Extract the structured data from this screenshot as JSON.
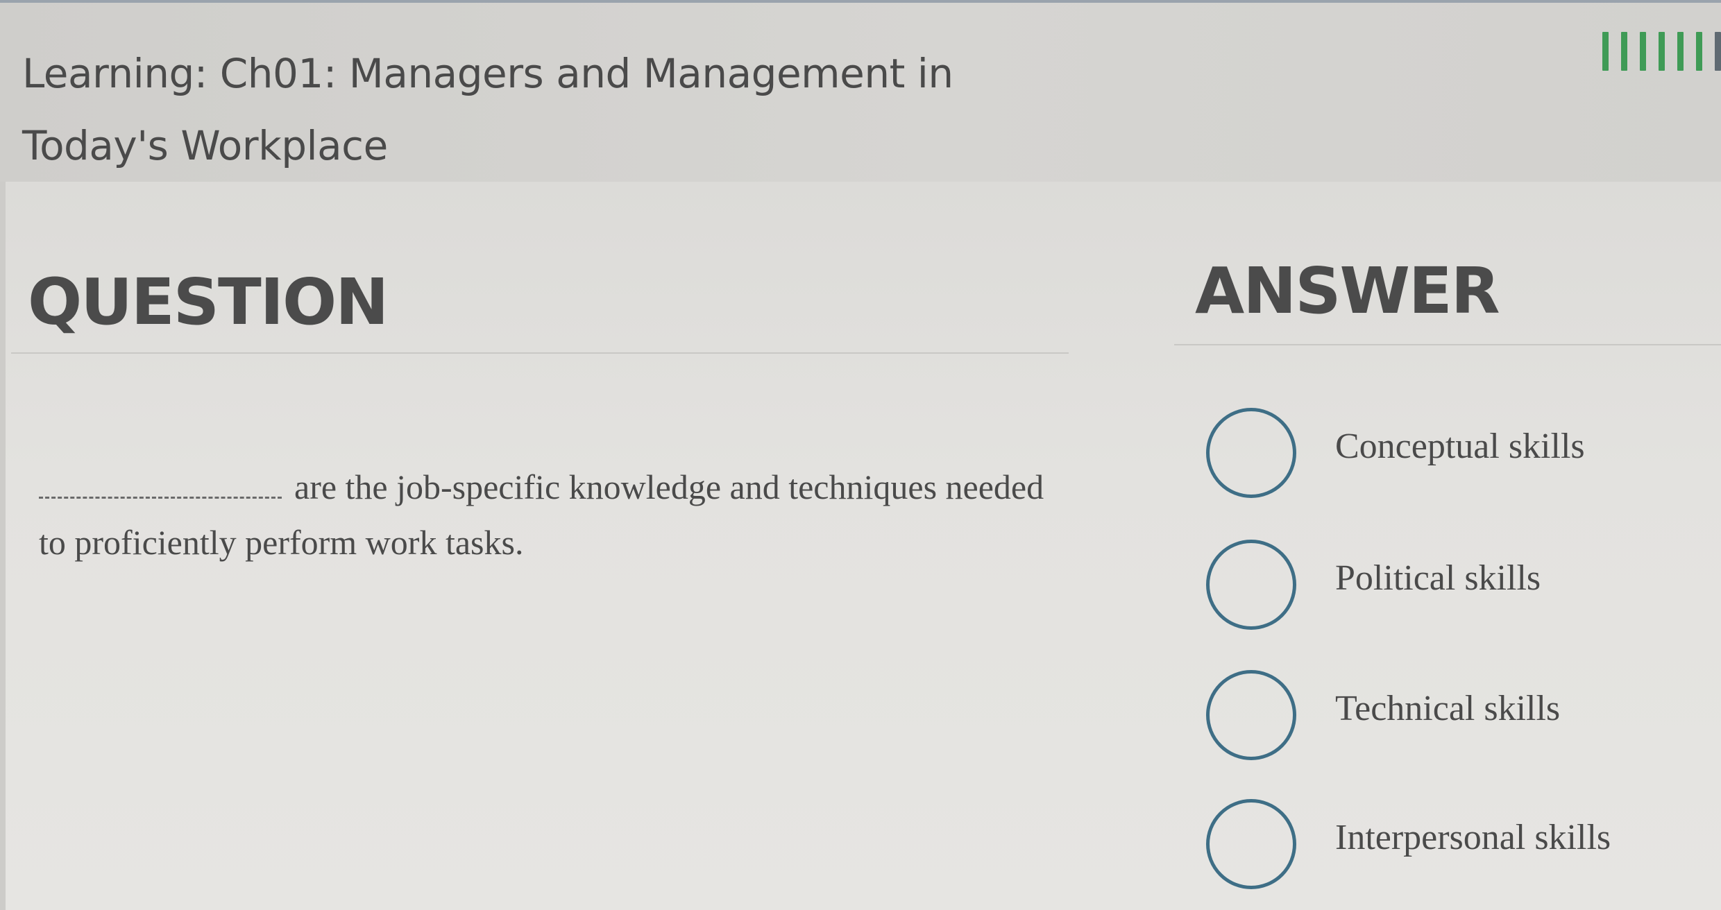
{
  "header": {
    "title": "Learning: Ch01: Managers and Management in Today's Workplace",
    "progress": {
      "completed": 6,
      "colors": {
        "completed": "#3f9b56",
        "current": "#5f6a72"
      }
    }
  },
  "question": {
    "heading": "QUESTION",
    "blank_display": "__________",
    "text": "are the job-specific knowledge and techniques needed to proficiently perform work tasks."
  },
  "answer": {
    "heading": "ANSWER",
    "options": [
      {
        "label": "Conceptual skills",
        "selected": false,
        "icon": "radio-circle-icon"
      },
      {
        "label": "Political skills",
        "selected": false,
        "icon": "radio-circle-icon"
      },
      {
        "label": "Technical skills",
        "selected": false,
        "icon": "radio-circle-icon"
      },
      {
        "label": "Interpersonal skills",
        "selected": false,
        "icon": "radio-circle-icon"
      }
    ]
  },
  "colors": {
    "radio_border": "#3e6e86",
    "text": "#4a4a4a",
    "header_bg": "#d2d1ce",
    "page_bg": "#e3e2df"
  }
}
